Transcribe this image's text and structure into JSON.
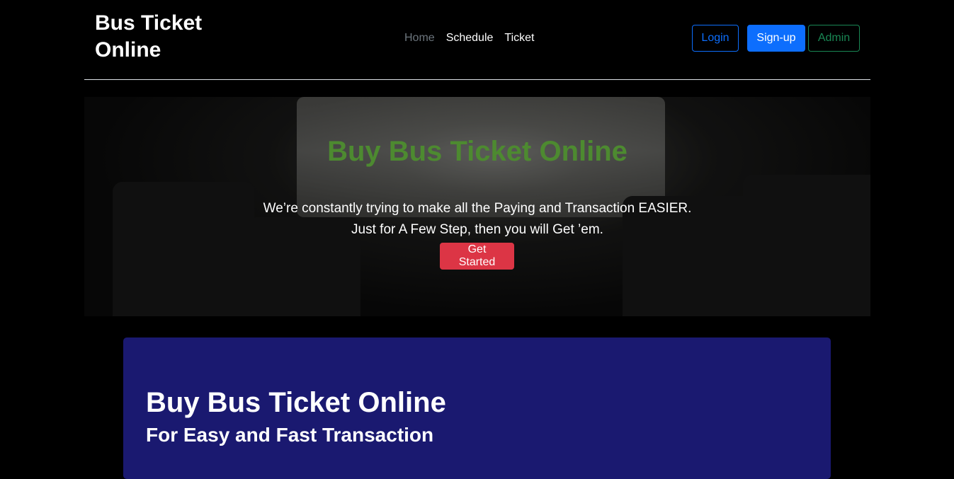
{
  "brand": "Bus Ticket Online",
  "nav": {
    "items": [
      {
        "label": "Home",
        "active": true
      },
      {
        "label": "Schedule"
      },
      {
        "label": "Ticket"
      }
    ]
  },
  "auth": {
    "login_label": "Login",
    "signup_label": "Sign-up",
    "admin_label": "Admin"
  },
  "hero": {
    "title": "Buy Bus Ticket Online",
    "text": "We’re constantly trying to make all the Paying and Transaction EASIER. Just for A Few Step, then you will Get ’em.",
    "cta_label": "Get Started",
    "title_color": "#4d8a30"
  },
  "jumbotron": {
    "title": "Buy Bus Ticket Online",
    "subtitle": "For Easy and Fast Transaction",
    "bg_color": "#1a1970"
  },
  "colors": {
    "primary": "#0d6efd",
    "success": "#198754",
    "danger": "#dc3545",
    "muted": "#6c757d"
  }
}
